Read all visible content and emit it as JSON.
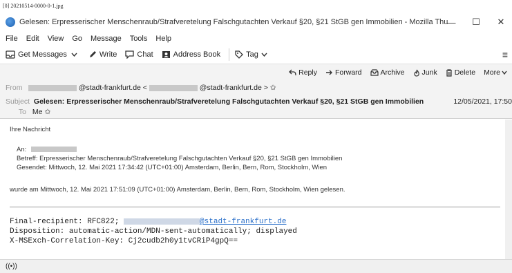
{
  "image_label": "[0] 20210514-0000-0-1.jpg",
  "window": {
    "title": "Gelesen: Erpresserischer Menschenraub/Strafveretelung Falschgutachten Verkauf §20, §21 StGB gen Immobilien - Mozilla Thunder...",
    "minimize": "—",
    "maximize": "☐",
    "close": "✕"
  },
  "menu": {
    "file": "File",
    "edit": "Edit",
    "view": "View",
    "go": "Go",
    "message": "Message",
    "tools": "Tools",
    "help": "Help"
  },
  "toolbar": {
    "get_messages": "Get Messages",
    "write": "Write",
    "chat": "Chat",
    "address_book": "Address Book",
    "tag": "Tag",
    "menu": "≡"
  },
  "header": {
    "actions": {
      "reply": "Reply",
      "forward": "Forward",
      "archive": "Archive",
      "junk": "Junk",
      "delete": "Delete",
      "more": "More"
    },
    "from_label": "From",
    "from_domain": "@stadt-frankfurt.de",
    "from_open": "<",
    "from_addr_domain": "@stadt-frankfurt.de",
    "from_close": ">",
    "star": "✩",
    "subject_label": "Subject",
    "subject": "Gelesen: Erpresserischer Menschenraub/Strafveretelung Falschgutachten Verkauf §20, §21 StGB gen Immobilien",
    "to_label": "To",
    "to_value": "Me",
    "date": "12/05/2021, 17:50"
  },
  "body": {
    "line1": "Ihre Nachricht",
    "an_label": "An:",
    "betreff": "Betreff: Erpresserischer Menschenraub/Strafveretelung Falschgutachten Verkauf §20, §21 StGB gen Immobilien",
    "gesendet": "Gesendet: Mittwoch, 12. Mai 2021 17:34:42 (UTC+01:00) Amsterdam, Berlin, Bern, Rom, Stockholm, Wien",
    "gelesen": "wurde am Mittwoch, 12. Mai 2021 17:51:09 (UTC+01:00) Amsterdam, Berlin, Bern, Rom, Stockholm, Wien gelesen.",
    "final_recipient_label": "Final-recipient: RFC822;",
    "final_recipient_domain": "@stadt-frankfurt.de",
    "disposition": "Disposition: automatic-action/MDN-sent-automatically; displayed",
    "correlation": "X-MSExch-Correlation-Key: Cj2cudb2h0y1tvCRiP4gpQ=="
  },
  "status": {
    "indicator": "((•))"
  }
}
